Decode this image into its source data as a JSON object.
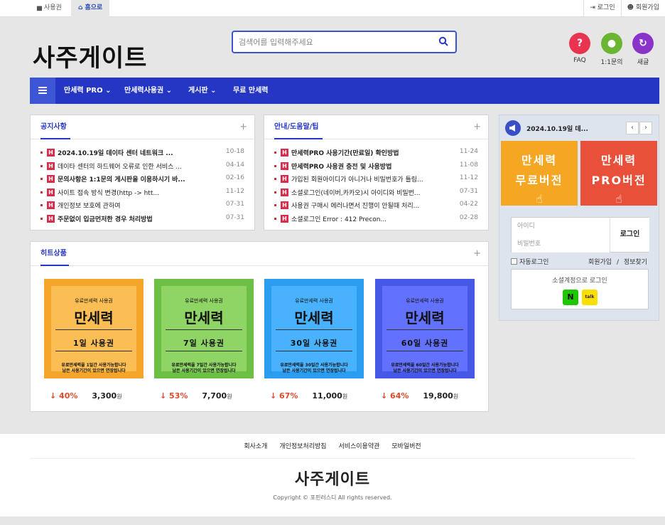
{
  "topbar": {
    "tabs": [
      {
        "icon": "briefcase-icon",
        "label": "사용권"
      },
      {
        "icon": "home-icon",
        "label": "홈으로"
      }
    ],
    "right": [
      {
        "icon": "login-icon",
        "label": "로그인"
      },
      {
        "icon": "user-plus-icon",
        "label": "회원가입"
      }
    ]
  },
  "header": {
    "logo": "사주게이트",
    "search_placeholder": "검색어를 입력해주세요",
    "quick": [
      {
        "icon": "question-icon",
        "label": "FAQ",
        "color": "#e8344e",
        "glyph": "?"
      },
      {
        "icon": "chat-icon",
        "label": "1:1문의",
        "color": "#6ab532",
        "glyph": "●"
      },
      {
        "icon": "refresh-icon",
        "label": "새글",
        "color": "#8a33c9",
        "glyph": "↻"
      }
    ]
  },
  "nav": {
    "items": [
      "만세력 PRO ⌄",
      "만세력사용권 ⌄",
      "게시판 ⌄",
      "무료 만세력"
    ]
  },
  "notice": {
    "title": "공지사항",
    "items": [
      {
        "text": "2024.10.19일 데이타 센터 네트워크 ...",
        "date": "10-18",
        "bold": true
      },
      {
        "text": "데이타 센터의 하드웨어 오류로 인한 서비스 ...",
        "date": "04-14",
        "bold": false
      },
      {
        "text": "문의사항은 1:1문의 게시판을 이용하시기 바...",
        "date": "02-16",
        "bold": true
      },
      {
        "text": "사이트 접속 방식 변경(http -> htt...",
        "date": "11-12",
        "bold": false
      },
      {
        "text": "개인정보 보호에 관하여",
        "date": "07-31",
        "bold": false
      },
      {
        "text": "주문없이 입금먼저한 경우 처리방법",
        "date": "07-31",
        "bold": true
      }
    ]
  },
  "guide": {
    "title": "안내/도움말/팁",
    "items": [
      {
        "text": "만세력PRO 사용기간(만료일) 확인방법",
        "date": "11-24",
        "bold": true
      },
      {
        "text": "만세력PRO 사용권 충전 및 사용방법",
        "date": "11-08",
        "bold": true
      },
      {
        "text": "가입된 회원아이디가 아니거나 비밀번호가 틀림...",
        "date": "11-12",
        "bold": false
      },
      {
        "text": "소셜로그인(네이버,카카오)시 아이디와 비밀번...",
        "date": "07-31",
        "bold": false
      },
      {
        "text": "사용권 구매시 에러나면서 진행이 안될때 처리...",
        "date": "04-22",
        "bold": false
      },
      {
        "text": "소셜로그인 Error : 412 Precon...",
        "date": "02-28",
        "bold": false
      }
    ]
  },
  "side": {
    "notice_title": "2024.10.19일 데...",
    "prev": "‹",
    "next": "›",
    "free": {
      "l1": "만세력",
      "l2": "무료버전",
      "color": "#f5a623"
    },
    "pro": {
      "l1": "만세력",
      "l2": "PRO버전",
      "color": "#e8503a"
    },
    "login": {
      "id_placeholder": "아이디",
      "pw_placeholder": "비밀번호",
      "button": "로그인",
      "auto": "자동로그인",
      "join": "회원가입",
      "slash": "/",
      "find": "정보찾기",
      "social_title": "소셜계정으로 로그인",
      "naver": "N",
      "kakao": "talk"
    }
  },
  "hits": {
    "title": "히트상품",
    "products": [
      {
        "top": "유료만세력 사용권",
        "name": "만세력",
        "period": "1일 사용권",
        "desc1": "유료만세력을 1일간 사용가능합니다",
        "desc2": "남은 사용기간이 있으면 연장됩니다",
        "pct": "↓ 40%",
        "price": "3,300",
        "won": "원",
        "bg": "#f5a52a",
        "card": "#fbbe55"
      },
      {
        "top": "유료만세력 사용권",
        "name": "만세력",
        "period": "7일 사용권",
        "desc1": "유료만세력을 7일간 사용가능합니다",
        "desc2": "남은 사용기간이 있으면 연장됩니다",
        "pct": "↓ 53%",
        "price": "7,700",
        "won": "원",
        "bg": "#6cc045",
        "card": "#8fd565"
      },
      {
        "top": "유료만세력 사용권",
        "name": "만세력",
        "period": "30일 사용권",
        "desc1": "유료만세력을 30일간 사용가능합니다",
        "desc2": "남은 사용기간이 있으면 연장됩니다",
        "pct": "↓ 67%",
        "price": "11,000",
        "won": "원",
        "bg": "#2a9df0",
        "card": "#49b2ff"
      },
      {
        "top": "유료만세력 사용권",
        "name": "만세력",
        "period": "60일 사용권",
        "desc1": "유료만세력을 60일간 사용가능합니다",
        "desc2": "남은 사용기간이 있으면 연장됩니다",
        "pct": "↓ 64%",
        "price": "19,800",
        "won": "원",
        "bg": "#4658e6",
        "card": "#6272ff"
      }
    ]
  },
  "footer": {
    "links": [
      "회사소개",
      "개인정보처리방침",
      "서비스이용약관",
      "모바일버전"
    ],
    "logo": "사주게이트",
    "copyright": "Copyright © 포핀러스디 All rights reserved."
  }
}
